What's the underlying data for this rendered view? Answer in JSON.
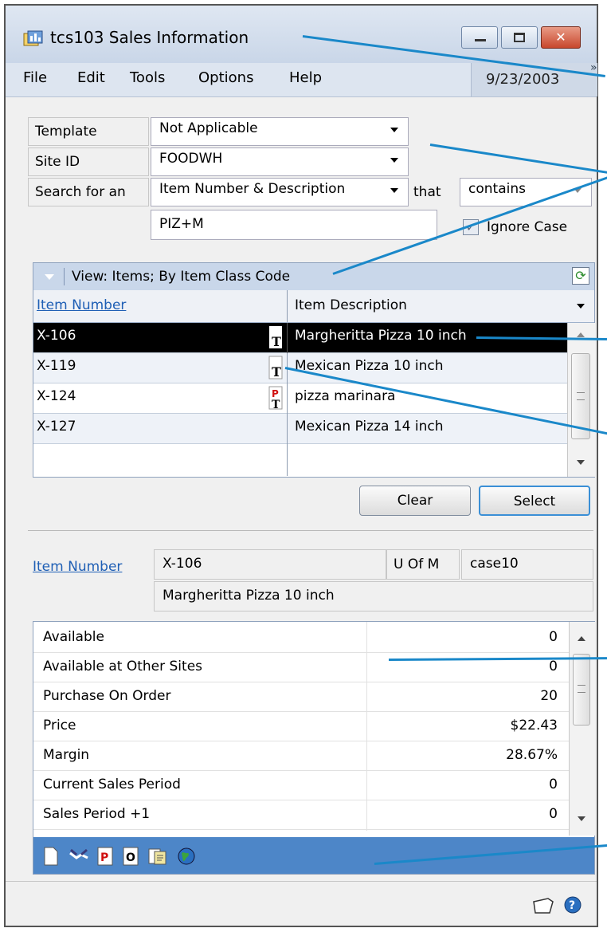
{
  "window": {
    "title": "tcs103 Sales Information"
  },
  "menu": {
    "items": [
      "File",
      "Edit",
      "Tools",
      "Options",
      "Help"
    ],
    "date": "9/23/2003",
    "more": "»"
  },
  "form": {
    "template_label": "Template",
    "template_value": "Not Applicable",
    "site_label": "Site ID",
    "site_value": "FOODWH",
    "search_label": "Search for an",
    "search_field": "Item Number & Description",
    "that_label": "that",
    "match_value": "contains",
    "search_text": "PIZ+M",
    "ignore_case_label": "Ignore Case",
    "ignore_case_checked": true
  },
  "grid": {
    "view_label": "View: Items; By Item Class Code",
    "col_item_number": "Item Number",
    "col_item_description": "Item Description",
    "rows": [
      {
        "number": "X-106",
        "description": "Margheritta Pizza 10 inch",
        "selected": true
      },
      {
        "number": "X-119",
        "description": "Mexican Pizza 10 inch"
      },
      {
        "number": "X-124",
        "description": "pizza marinara"
      },
      {
        "number": "X-127",
        "description": "Mexican Pizza 14 inch"
      }
    ]
  },
  "buttons": {
    "clear": "Clear",
    "select": "Select"
  },
  "detail": {
    "item_number_label": "Item Number",
    "item_number": "X-106",
    "uofm_label": "U Of M",
    "uofm": "case10",
    "description": "Margheritta Pizza 10 inch"
  },
  "stats": [
    {
      "label": "Available",
      "value": "0"
    },
    {
      "label": "Available at Other Sites",
      "value": "0"
    },
    {
      "label": "Purchase On Order",
      "value": "20"
    },
    {
      "label": "Price",
      "value": "$22.43"
    },
    {
      "label": "Margin",
      "value": "28.67%"
    },
    {
      "label": "Current Sales Period",
      "value": "0"
    },
    {
      "label": "Sales Period +1",
      "value": "0"
    }
  ],
  "colors": {
    "title_bar": "#c9d6e8",
    "selected_row": "#000000",
    "toolbar": "#4d86c8",
    "callout_line": "#1a88c9"
  }
}
